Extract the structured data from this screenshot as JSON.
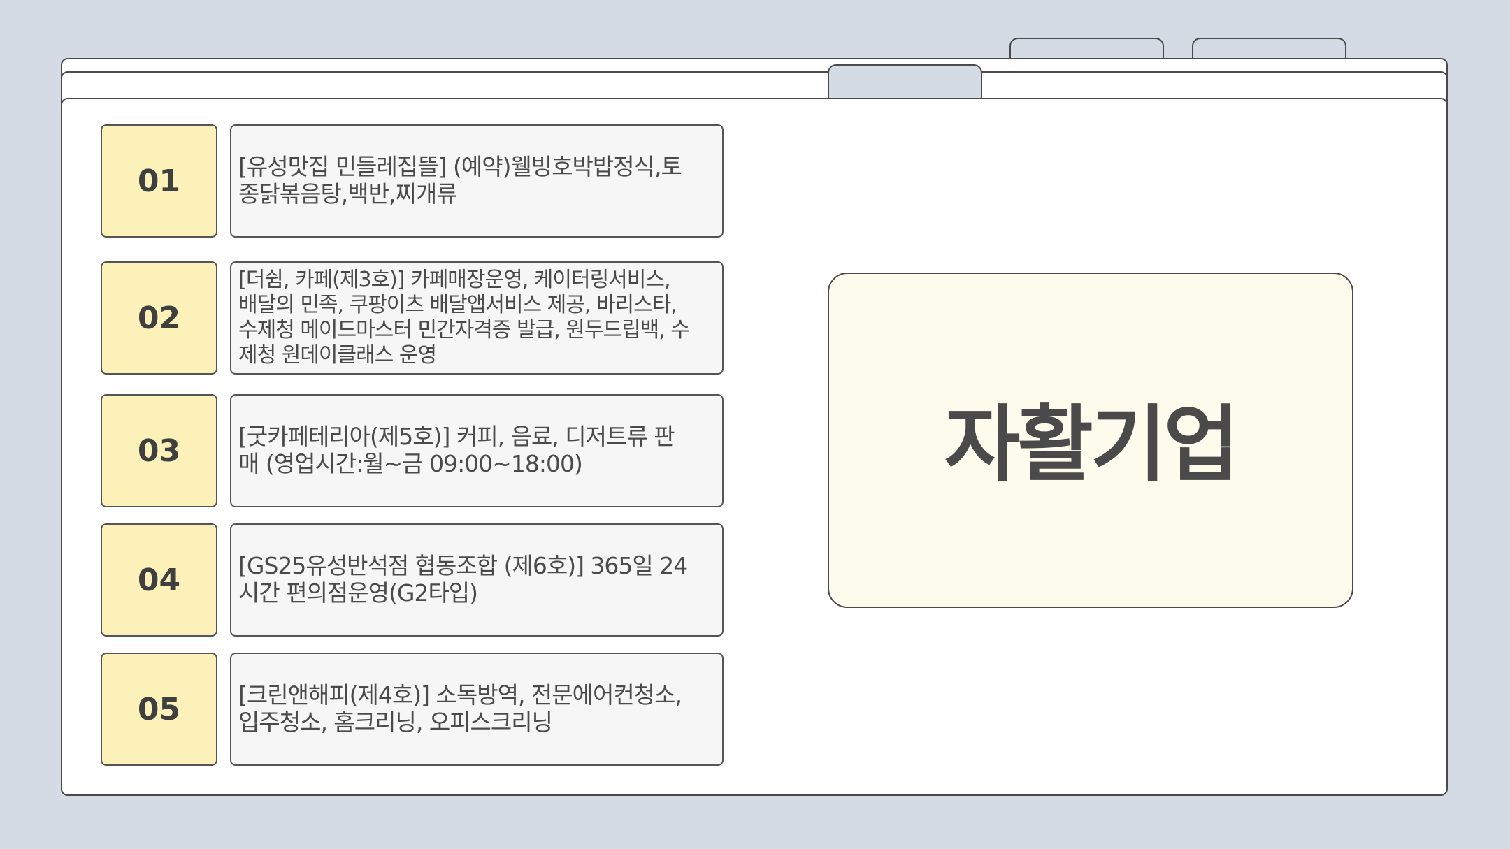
{
  "title": "자활기업",
  "items": [
    {
      "number": "01",
      "text": "[유성맛집 민들레집뜰] (예약)웰빙호박밥정식,토종닭볶음탕,백반,찌개류"
    },
    {
      "number": "02",
      "text": "[더쉼, 카페(제3호)] 카페매장운영, 케이터링서비스, 배달의 민족, 쿠팡이츠 배달앱서비스 제공, 바리스타, 수제청 메이드마스터 민간자격증 발급, 원두드립백, 수제청 원데이클래스 운영"
    },
    {
      "number": "03",
      "text": "[굿카페테리아(제5호)] 커피, 음료, 디저트류 판매 (영업시간:월~금 09:00~18:00)"
    },
    {
      "number": "04",
      "text": "[GS25유성반석점 협동조합 (제6호)] 365일 24시간 편의점운영(G2타입)"
    },
    {
      "number": "05",
      "text": "[크린앤해피(제4호)] 소독방역, 전문에어컨청소, 입주청소, 홈크리닝, 오피스크리닝"
    }
  ]
}
